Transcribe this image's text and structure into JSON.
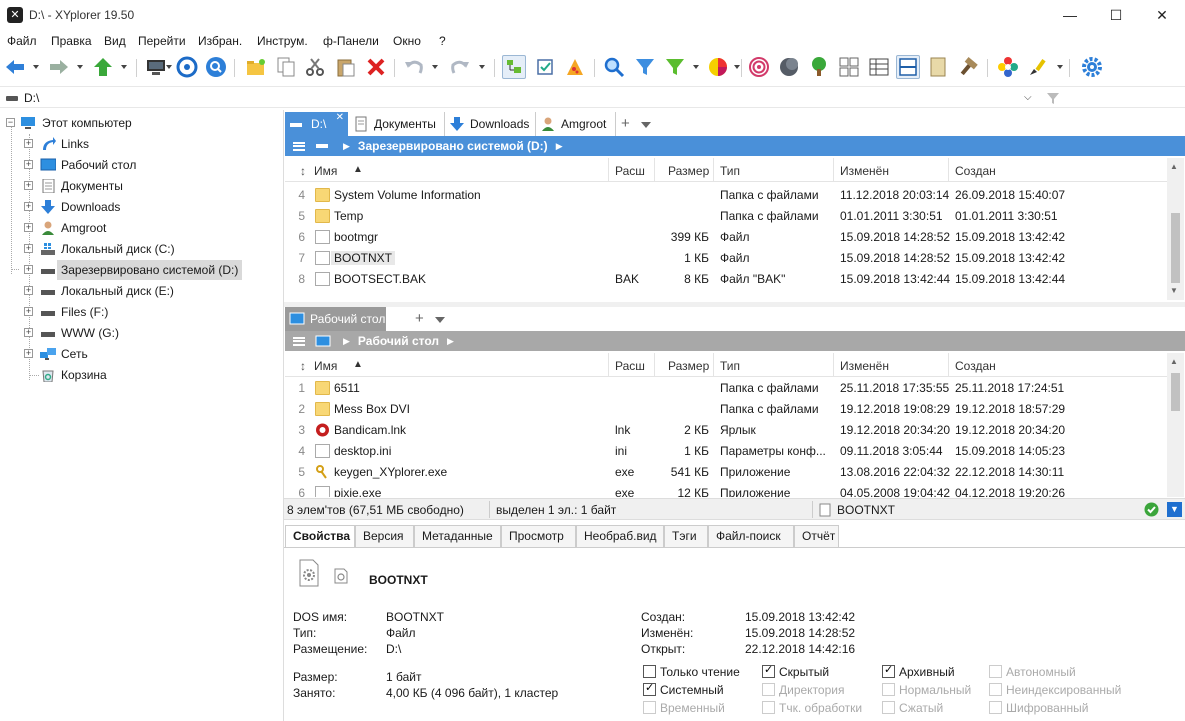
{
  "window": {
    "title": "D:\\ - XYplorer 19.50",
    "min": "—",
    "max": "☐",
    "close": "✕"
  },
  "menu": [
    "Файл",
    "Правка",
    "Вид",
    "Перейти",
    "Избран.",
    "Инструм.",
    "ф-Панели",
    "Окно",
    "?"
  ],
  "address": {
    "value": "D:\\"
  },
  "tree": {
    "root": "Этот компьютер",
    "items": [
      "Links",
      "Рабочий стол",
      "Документы",
      "Downloads",
      "Amgroot",
      "Локальный диск (C:)",
      "Зарезервировано системой (D:)",
      "Локальный диск (E:)",
      "Files (F:)",
      "WWW (G:)",
      "Сеть",
      "Корзина"
    ]
  },
  "pane1": {
    "tabs": [
      "D:\\",
      "Документы",
      "Downloads",
      "Amgroot"
    ],
    "breadcrumb": "Зарезервировано системой (D:)",
    "columns": {
      "name": "Имя",
      "ext": "Расш",
      "size": "Размер",
      "type": "Тип",
      "modified": "Изменён",
      "created": "Создан"
    },
    "rows": [
      {
        "n": "4",
        "name": "System Volume Information",
        "ext": "",
        "size": "",
        "type": "Папка с файлами",
        "modified": "11.12.2018 20:03:14",
        "created": "26.09.2018 15:40:07",
        "kind": "folder"
      },
      {
        "n": "5",
        "name": "Temp",
        "ext": "",
        "size": "",
        "type": "Папка с файлами",
        "modified": "01.01.2011 3:30:51",
        "created": "01.01.2011 3:30:51",
        "kind": "folder"
      },
      {
        "n": "6",
        "name": "bootmgr",
        "ext": "",
        "size": "399 КБ",
        "type": "Файл",
        "modified": "15.09.2018 14:28:52",
        "created": "15.09.2018 13:42:42",
        "kind": "file"
      },
      {
        "n": "7",
        "name": "BOOTNXT",
        "ext": "",
        "size": "1 КБ",
        "type": "Файл",
        "modified": "15.09.2018 14:28:52",
        "created": "15.09.2018 13:42:42",
        "kind": "file"
      },
      {
        "n": "8",
        "name": "BOOTSECT.BAK",
        "ext": "BAK",
        "size": "8 КБ",
        "type": "Файл \"BAK\"",
        "modified": "15.09.2018 13:42:44",
        "created": "15.09.2018 13:42:44",
        "kind": "file"
      }
    ]
  },
  "pane2": {
    "tabs": [
      "Рабочий стол"
    ],
    "breadcrumb": "Рабочий стол",
    "columns": {
      "name": "Имя",
      "ext": "Расш",
      "size": "Размер",
      "type": "Тип",
      "modified": "Изменён",
      "created": "Создан"
    },
    "rows": [
      {
        "n": "1",
        "name": "6511",
        "ext": "",
        "size": "",
        "type": "Папка с файлами",
        "modified": "25.11.2018 17:35:55",
        "created": "25.11.2018 17:24:51",
        "kind": "folder"
      },
      {
        "n": "2",
        "name": "Mess Box DVI",
        "ext": "",
        "size": "",
        "type": "Папка с файлами",
        "modified": "19.12.2018 19:08:29",
        "created": "19.12.2018 18:57:29",
        "kind": "folder"
      },
      {
        "n": "3",
        "name": "Bandicam.lnk",
        "ext": "lnk",
        "size": "2 КБ",
        "type": "Ярлык",
        "modified": "19.12.2018 20:34:20",
        "created": "19.12.2018 20:34:20",
        "kind": "bandicam"
      },
      {
        "n": "4",
        "name": "desktop.ini",
        "ext": "ini",
        "size": "1 КБ",
        "type": "Параметры конф...",
        "modified": "09.11.2018 3:05:44",
        "created": "15.09.2018 14:05:23",
        "kind": "file"
      },
      {
        "n": "5",
        "name": "keygen_XYplorer.exe",
        "ext": "exe",
        "size": "541 КБ",
        "type": "Приложение",
        "modified": "13.08.2016 22:04:32",
        "created": "22.12.2018 14:30:11",
        "kind": "key"
      },
      {
        "n": "6",
        "name": "pixie.exe",
        "ext": "exe",
        "size": "12 КБ",
        "type": "Приложение",
        "modified": "04.05.2008 19:04:42",
        "created": "04.12.2018 19:20:26",
        "kind": "file"
      }
    ]
  },
  "status": {
    "count": "8 элем'тов (67,51 МБ свободно)",
    "selected": "выделен 1 эл.: 1 байт",
    "file": "BOOTNXT"
  },
  "infotabs": [
    "Свойства",
    "Версия",
    "Метаданные",
    "Просмотр",
    "Необраб.вид",
    "Тэги",
    "Файл-поиск",
    "Отчёт"
  ],
  "props": {
    "filename": "BOOTNXT",
    "dos_label": "DOS имя:",
    "dos": "BOOTNXT",
    "type_label": "Тип:",
    "type": "Файл",
    "loc_label": "Размещение:",
    "loc": "D:\\",
    "size_label": "Размер:",
    "size": "1 байт",
    "occupied_label": "Занято:",
    "occupied": "4,00 КБ (4 096 байт), 1 кластер",
    "created_label": "Создан:",
    "created": "15.09.2018 13:42:42",
    "modified_label": "Изменён:",
    "modified": "15.09.2018 14:28:52",
    "opened_label": "Открыт:",
    "opened": "22.12.2018 14:42:16"
  },
  "attrs": [
    {
      "label": "Только чтение",
      "on": false,
      "dis": false
    },
    {
      "label": "Скрытый",
      "on": true,
      "dis": false
    },
    {
      "label": "Архивный",
      "on": true,
      "dis": false
    },
    {
      "label": "Автономный",
      "on": false,
      "dis": true
    },
    {
      "label": "Системный",
      "on": true,
      "dis": false
    },
    {
      "label": "Директория",
      "on": false,
      "dis": true
    },
    {
      "label": "Нормальный",
      "on": false,
      "dis": true
    },
    {
      "label": "Неиндексированный",
      "on": false,
      "dis": true
    },
    {
      "label": "Временный",
      "on": false,
      "dis": true
    },
    {
      "label": "Тчк. обработки",
      "on": false,
      "dis": true
    },
    {
      "label": "Сжатый",
      "on": false,
      "dis": true
    },
    {
      "label": "Шифрованный",
      "on": false,
      "dis": true
    }
  ]
}
